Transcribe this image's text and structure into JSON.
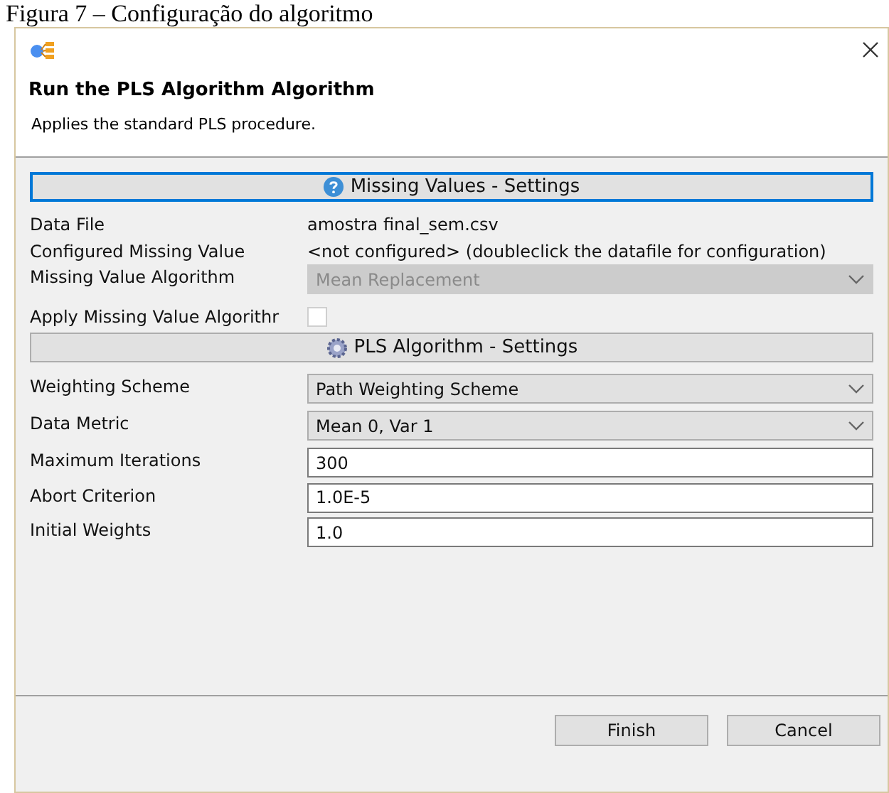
{
  "caption": "Figura 7 – Configuração do algoritmo",
  "dialog": {
    "title": "Run the PLS Algorithm Algorithm",
    "description": "Applies the standard PLS procedure."
  },
  "sections": [
    {
      "header": "Missing Values - Settings",
      "kind": "help",
      "focused": true,
      "rows": [
        {
          "kind": "text",
          "label": "Data File",
          "value": "amostra final_sem.csv"
        },
        {
          "kind": "text",
          "label": "Configured Missing Value",
          "value": "<not configured> (doubleclick the datafile for configuration)"
        },
        {
          "kind": "dropdown",
          "label": "Missing Value Algorithm",
          "value": "Mean Replacement",
          "disabled": true
        },
        {
          "kind": "checkbox",
          "label": "Apply Missing Value Algorithr",
          "checked": false
        }
      ]
    },
    {
      "header": "PLS Algorithm - Settings",
      "kind": "gear",
      "focused": false,
      "rows": [
        {
          "kind": "dropdown",
          "label": "Weighting Scheme",
          "value": "Path Weighting Scheme",
          "disabled": false
        },
        {
          "kind": "dropdown",
          "label": "Data Metric",
          "value": "Mean 0, Var 1",
          "disabled": false
        },
        {
          "kind": "field",
          "label": "Maximum Iterations",
          "value": "300"
        },
        {
          "kind": "field",
          "label": "Abort Criterion",
          "value": "1.0E-5"
        },
        {
          "kind": "field",
          "label": "Initial Weights",
          "value": "1.0"
        }
      ]
    }
  ],
  "buttons": [
    "Finish",
    "Cancel"
  ]
}
